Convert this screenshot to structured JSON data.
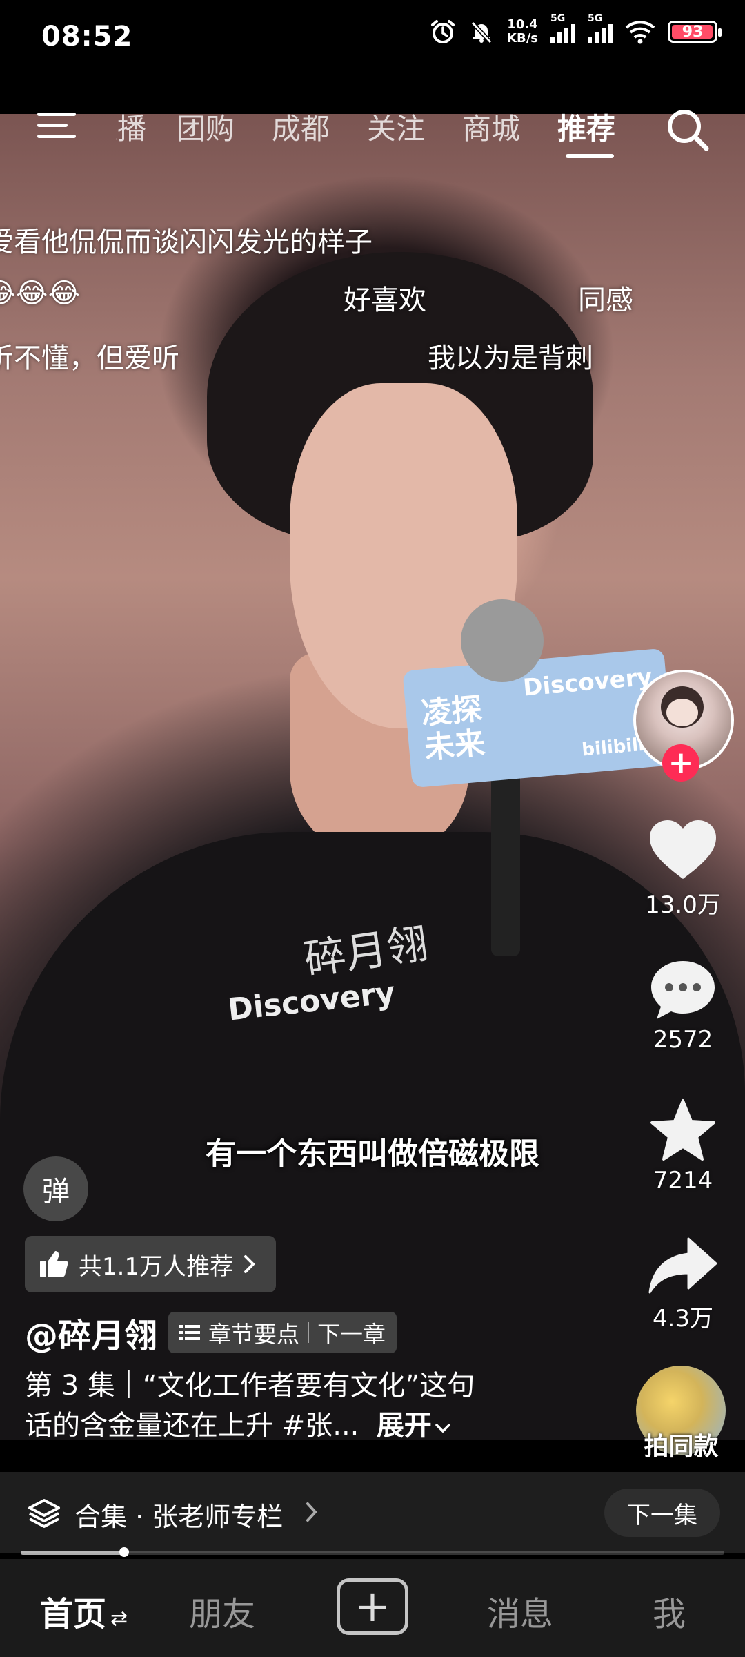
{
  "status_bar": {
    "time": "08:52",
    "net_speed_value": "10.4",
    "net_speed_unit": "KB/s",
    "sig1_label": "5G",
    "sig2_label": "5G",
    "battery": "93",
    "battery_color": "#ff4d67"
  },
  "top_nav": {
    "tabs": [
      {
        "label": "直播"
      },
      {
        "label": "团购"
      },
      {
        "label": "成都"
      },
      {
        "label": "关注"
      },
      {
        "label": "商城"
      },
      {
        "label": "推荐"
      }
    ],
    "active_tab": "推荐"
  },
  "danmaku": [
    {
      "text": "爱看他侃侃而谈闪闪发光的样子"
    },
    {
      "text": "😂😂😂"
    },
    {
      "text": "好喜欢"
    },
    {
      "text": "同感"
    },
    {
      "text": "听不懂，但爱听"
    },
    {
      "text": "我以为是背刺"
    }
  ],
  "video": {
    "mic_brand": "Discovery",
    "mic_title_line1": "凌探",
    "mic_title_line2": "未来",
    "mic_sub": "bilibili",
    "shirt_brand": "Discovery",
    "shirt_title": "碎月翎",
    "subtitle": "有一个东西叫做倍磁极限"
  },
  "side_actions": {
    "likes": "13.0万",
    "comments": "2572",
    "favorites": "7214",
    "shares": "4.3万",
    "same_style": "拍同款"
  },
  "danmaku_button": "弹",
  "recommend": {
    "text": "共1.1万人推荐"
  },
  "author": {
    "name": "@碎月翎"
  },
  "chapter": {
    "points": "章节要点",
    "next": "下一章"
  },
  "description": {
    "line1": "第 3 集｜“文化工作者要有文化”这句",
    "line2": "话的含金量还在上升 #张...",
    "expand": "展开"
  },
  "collection": {
    "text": "合集 · 张老师专栏",
    "next_episode": "下一集"
  },
  "progress": {
    "fraction": 0.147
  },
  "bottom_nav": {
    "home": "首页",
    "friends": "朋友",
    "messages": "消息",
    "me": "我"
  },
  "colors": {
    "accent_red": "#fe2c55"
  }
}
